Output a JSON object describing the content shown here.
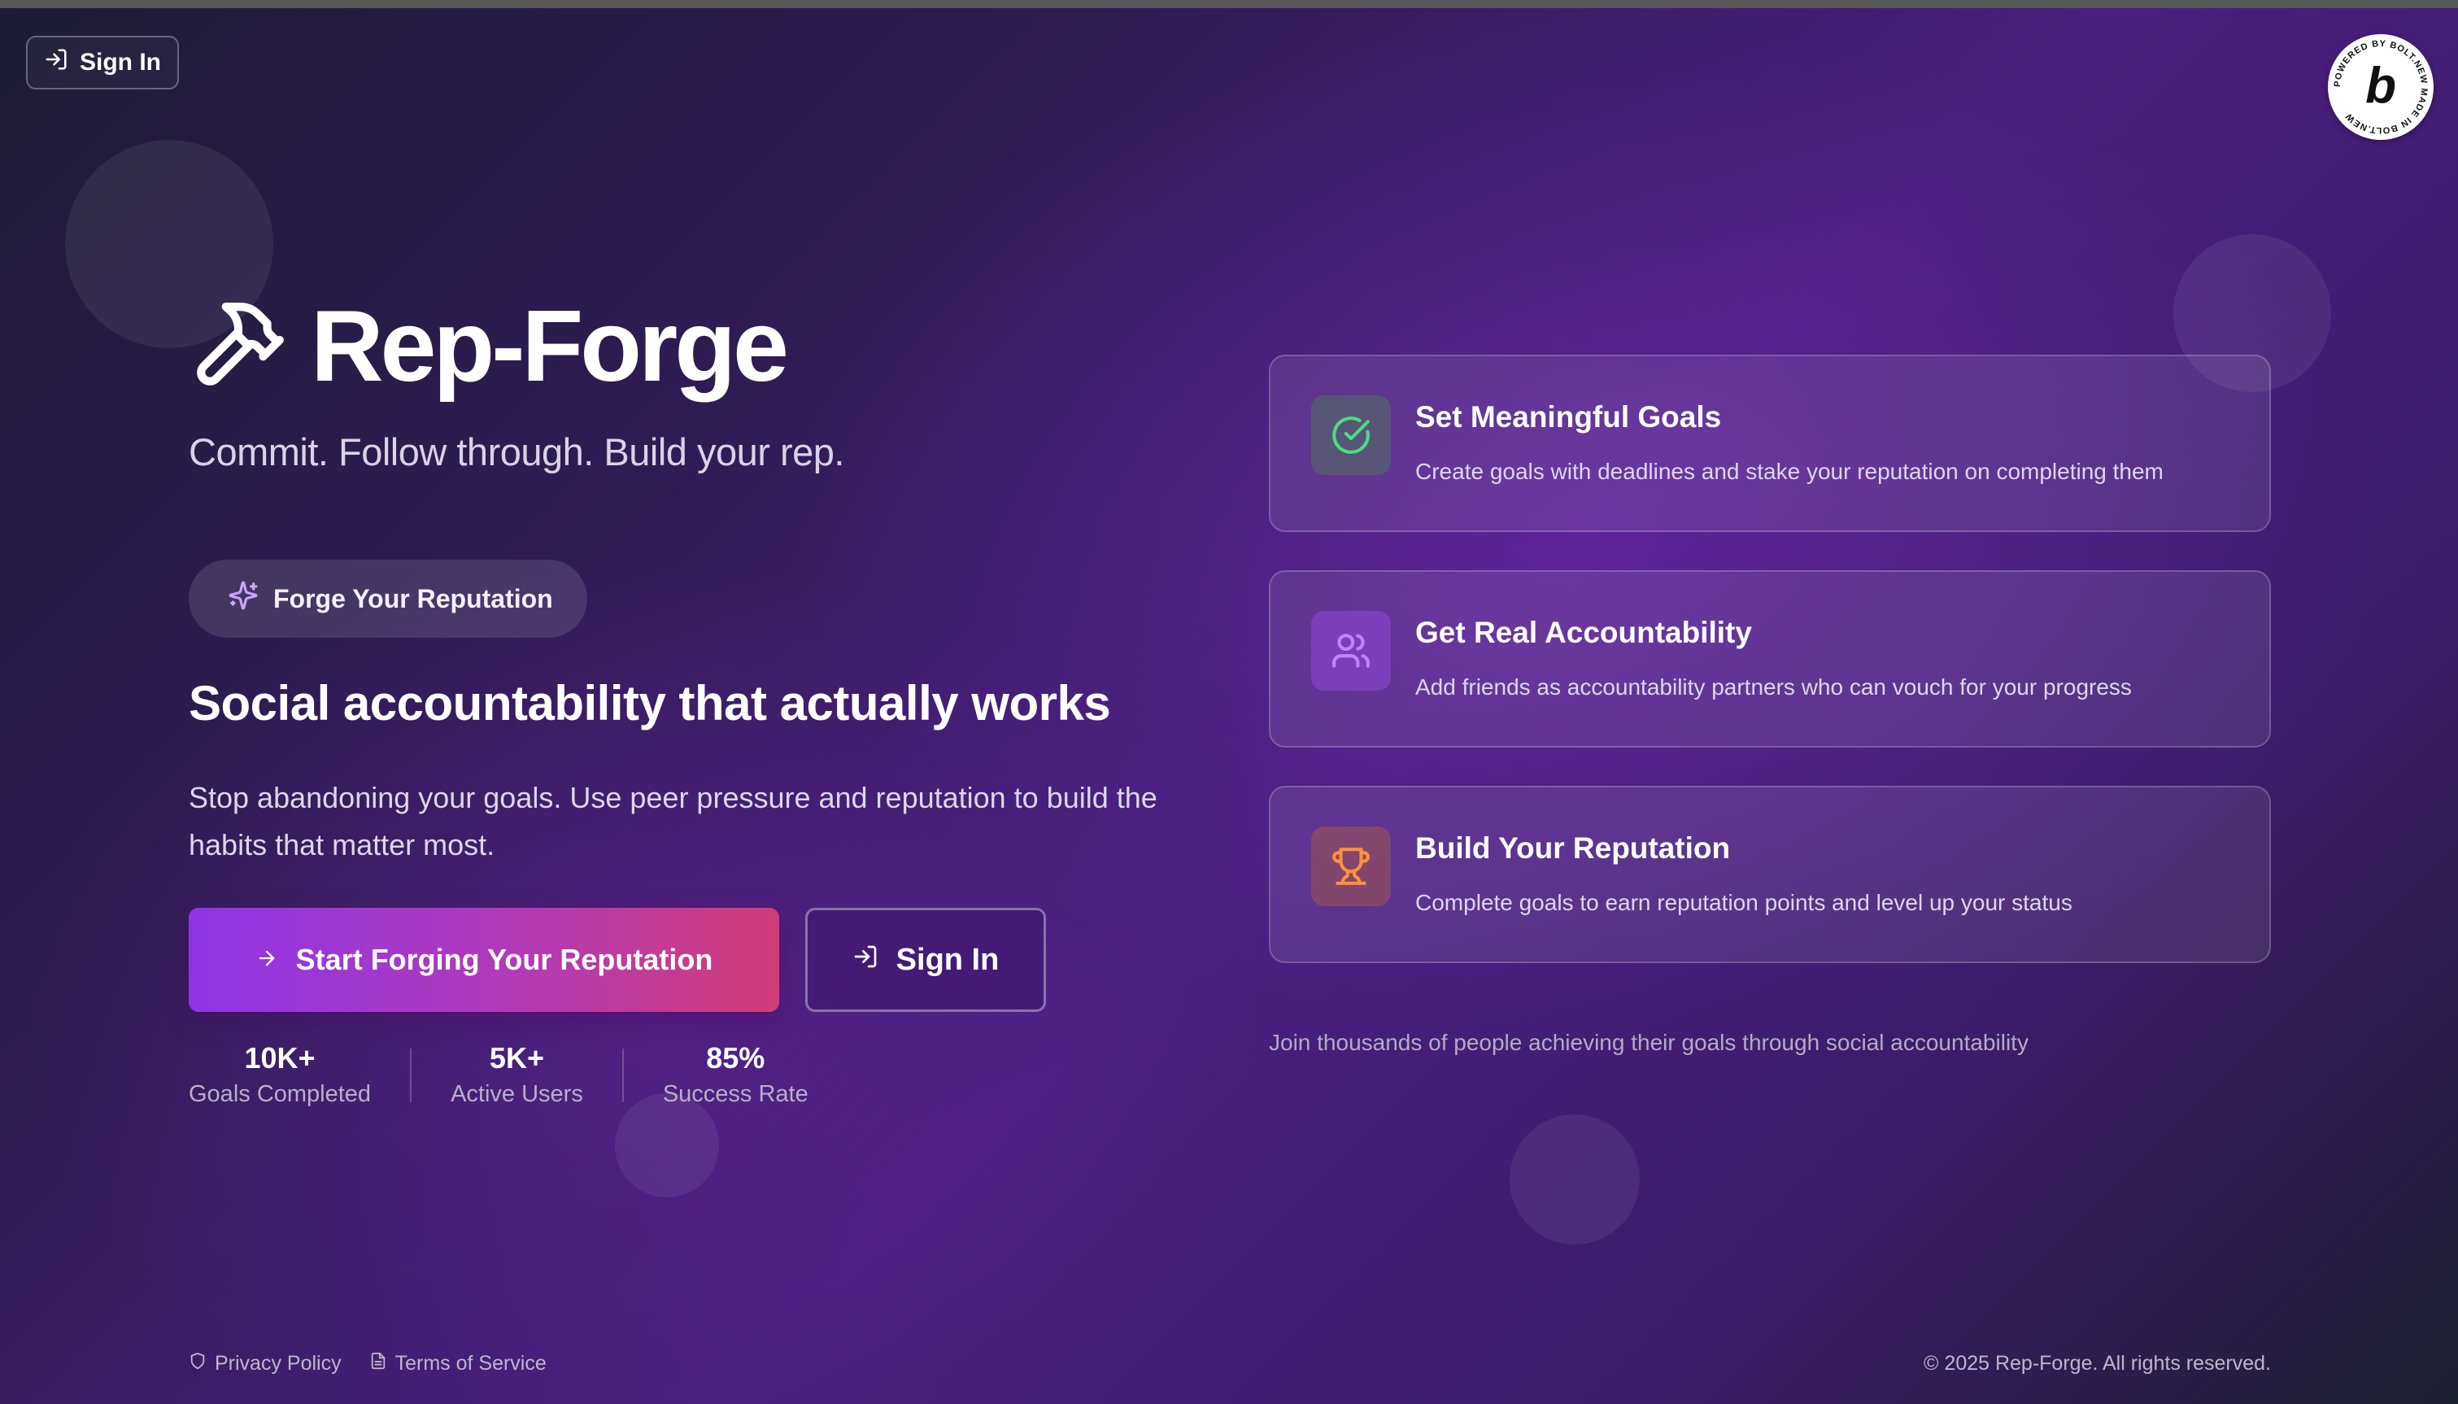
{
  "header": {
    "signin_label": "Sign In"
  },
  "bolt_badge": {
    "letter": "b",
    "ring_text": "POWERED BY BOLT.NEW MADE IN BOLT.NEW"
  },
  "hero": {
    "title": "Rep-Forge",
    "tagline": "Commit. Follow through. Build your rep.",
    "pill_label": "Forge Your Reputation",
    "headline": "Social accountability that actually works",
    "description": "Stop abandoning your goals. Use peer pressure and reputation to build the habits that matter most.",
    "primary_cta": "Start Forging Your Reputation",
    "secondary_cta": "Sign In"
  },
  "stats": [
    {
      "value": "10K+",
      "label": "Goals Completed"
    },
    {
      "value": "5K+",
      "label": "Active Users"
    },
    {
      "value": "85%",
      "label": "Success Rate"
    }
  ],
  "features": [
    {
      "icon": "check-circle-icon",
      "title": "Set Meaningful Goals",
      "description": "Create goals with deadlines and stake your reputation on completing them",
      "accent": "#4ade80"
    },
    {
      "icon": "users-icon",
      "title": "Get Real Accountability",
      "description": "Add friends as accountability partners who can vouch for your progress",
      "accent": "#c084fc"
    },
    {
      "icon": "trophy-icon",
      "title": "Build Your Reputation",
      "description": "Complete goals to earn reputation points and level up your status",
      "accent": "#fb923c"
    }
  ],
  "join_text": "Join thousands of people achieving their goals through social accountability",
  "footer": {
    "privacy": "Privacy Policy",
    "terms": "Terms of Service",
    "copyright": "© 2025 Rep-Forge. All rights reserved."
  }
}
